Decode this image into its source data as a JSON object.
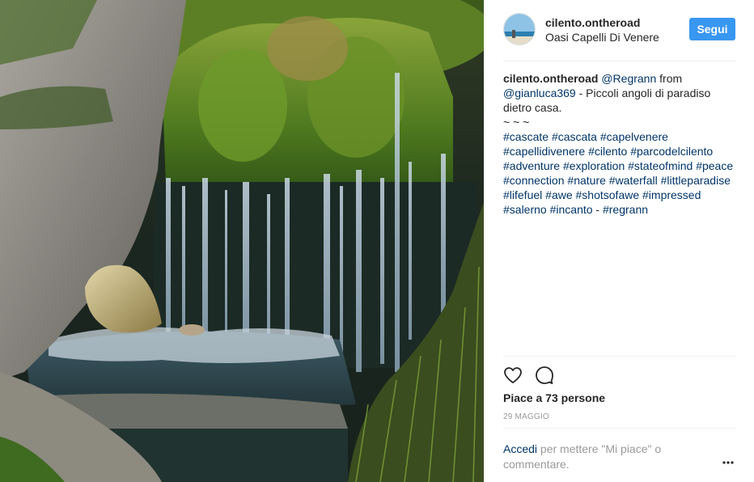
{
  "post": {
    "username": "cilento.ontheroad",
    "location": "Oasi Capelli Di Venere",
    "follow_label": "Segui"
  },
  "caption": {
    "username": "cilento.ontheroad",
    "mention1": "@Regrann",
    "from_text": " from ",
    "mention2": "@gianluca369",
    "text": " - Piccoli angoli di paradiso dietro casa.",
    "tilde": "~ ~ ~",
    "hashtags": [
      "#cascate",
      "#cascata",
      "#capelvenere",
      "#capellidivenere",
      "#cilento",
      "#parcodelcilento",
      "#adventure",
      "#exploration",
      "#stateofmind",
      "#peace",
      "#connection",
      "#nature",
      "#waterfall",
      "#littleparadise",
      "#lifefuel",
      "#awe",
      "#shotsofawe",
      "#impressed",
      "#salerno",
      "#incanto"
    ],
    "tail_sep": " - ",
    "tail_tag": "#regrann"
  },
  "engagement": {
    "likes": "Piace a 73 persone",
    "date": "29 maggio"
  },
  "login_prompt": {
    "link": "Accedi",
    "text": " per mettere \"Mi piace\" o commentare."
  },
  "icons": {
    "like": "heart-outline-icon",
    "comment": "comment-bubble-icon",
    "more": "more-options-icon"
  },
  "colors": {
    "follow_button": "#3897f0",
    "link": "#003569",
    "muted": "#999999"
  }
}
